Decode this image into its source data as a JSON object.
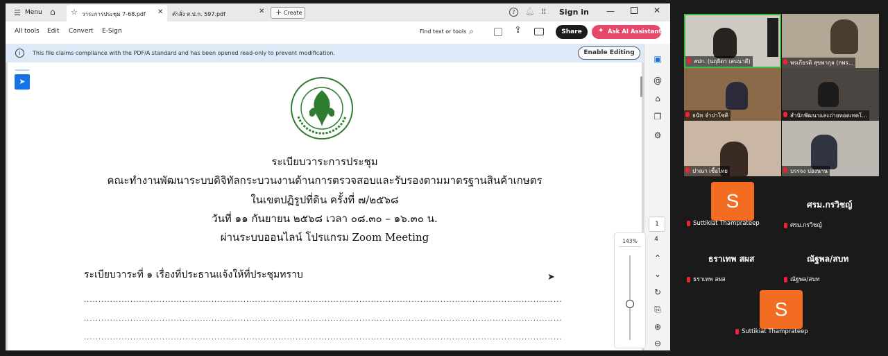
{
  "tabs": {
    "menu_label": "Menu",
    "tab1": "วาระการประชุม 7-68.pdf",
    "tab2": "คำสั่ง ส.ป.ก. 597.pdf",
    "create_label": "Create",
    "sign_in": "Sign in"
  },
  "toolbar": {
    "all_tools": "All tools",
    "edit": "Edit",
    "convert": "Convert",
    "esign": "E-Sign",
    "find": "Find text or tools",
    "share": "Share",
    "ask_ai": "Ask AI Assistant"
  },
  "infobar": {
    "message": "This file claims compliance with the PDF/A standard and has been opened read-only to prevent modification.",
    "enable_editing": "Enable Editing"
  },
  "document": {
    "title": "ระเบียบวาระการประชุม",
    "line2": "คณะทำงานพัฒนาระบบดิจิทัลกระบวนงานด้านการตรวจสอบและรับรองตามมาตรฐานสินค้าเกษตร",
    "line3": "ในเขตปฏิรูปที่ดิน ครั้งที่ ๗/๒๕๖๘",
    "line4": "วันที่ ๑๑ กันยายน ๒๕๖๘ เวลา ๐๘.๓๐ – ๑๖.๓๐ น.",
    "line5": "ผ่านระบบออนไลน์ โปรแกรม Zoom Meeting",
    "agenda1": "ระเบียบวาระที่ ๑    เรื่องที่ประธานแจ้งให้ที่ประชุมทราบ",
    "dots": "......................................................................................................................................................................................"
  },
  "page_nav": {
    "current_page": "1",
    "total_pages": "4",
    "zoom": "143%"
  },
  "participants": {
    "p1": "สปก. (นฤธิดา เสนนาดี)",
    "p2": "พรเกียรติ สุขพากุล (กพร...",
    "p3": "ธนัท จำปาโซติ",
    "p4": "สำนักพัฒนาและถ่ายทอดเทคโ...",
    "p5": "ปาณา เชื้อไทย",
    "p6": "บรรจง ปองนาน",
    "p7_avatar": "S",
    "p7": "Suttikiat Thamprateep",
    "p8_big": "ศรม.กรวิชญ์",
    "p8": "ศรม.กรวิชญ์",
    "p9_big": "ธราเทพ สผส",
    "p9": "ธราเทพ สผส",
    "p10_big": "ณัฐพล/สบท",
    "p10": "ณัฐพล/สบท",
    "p11_avatar": "S",
    "p11": "Suttikiat Thamprateep"
  },
  "colors": {
    "share_bg": "#1b1b1b",
    "ask_ai_bg": "#e8476a",
    "avatar_orange": "#f26d21",
    "seal_green": "#2e7d32",
    "select_blue": "#1473e6"
  }
}
